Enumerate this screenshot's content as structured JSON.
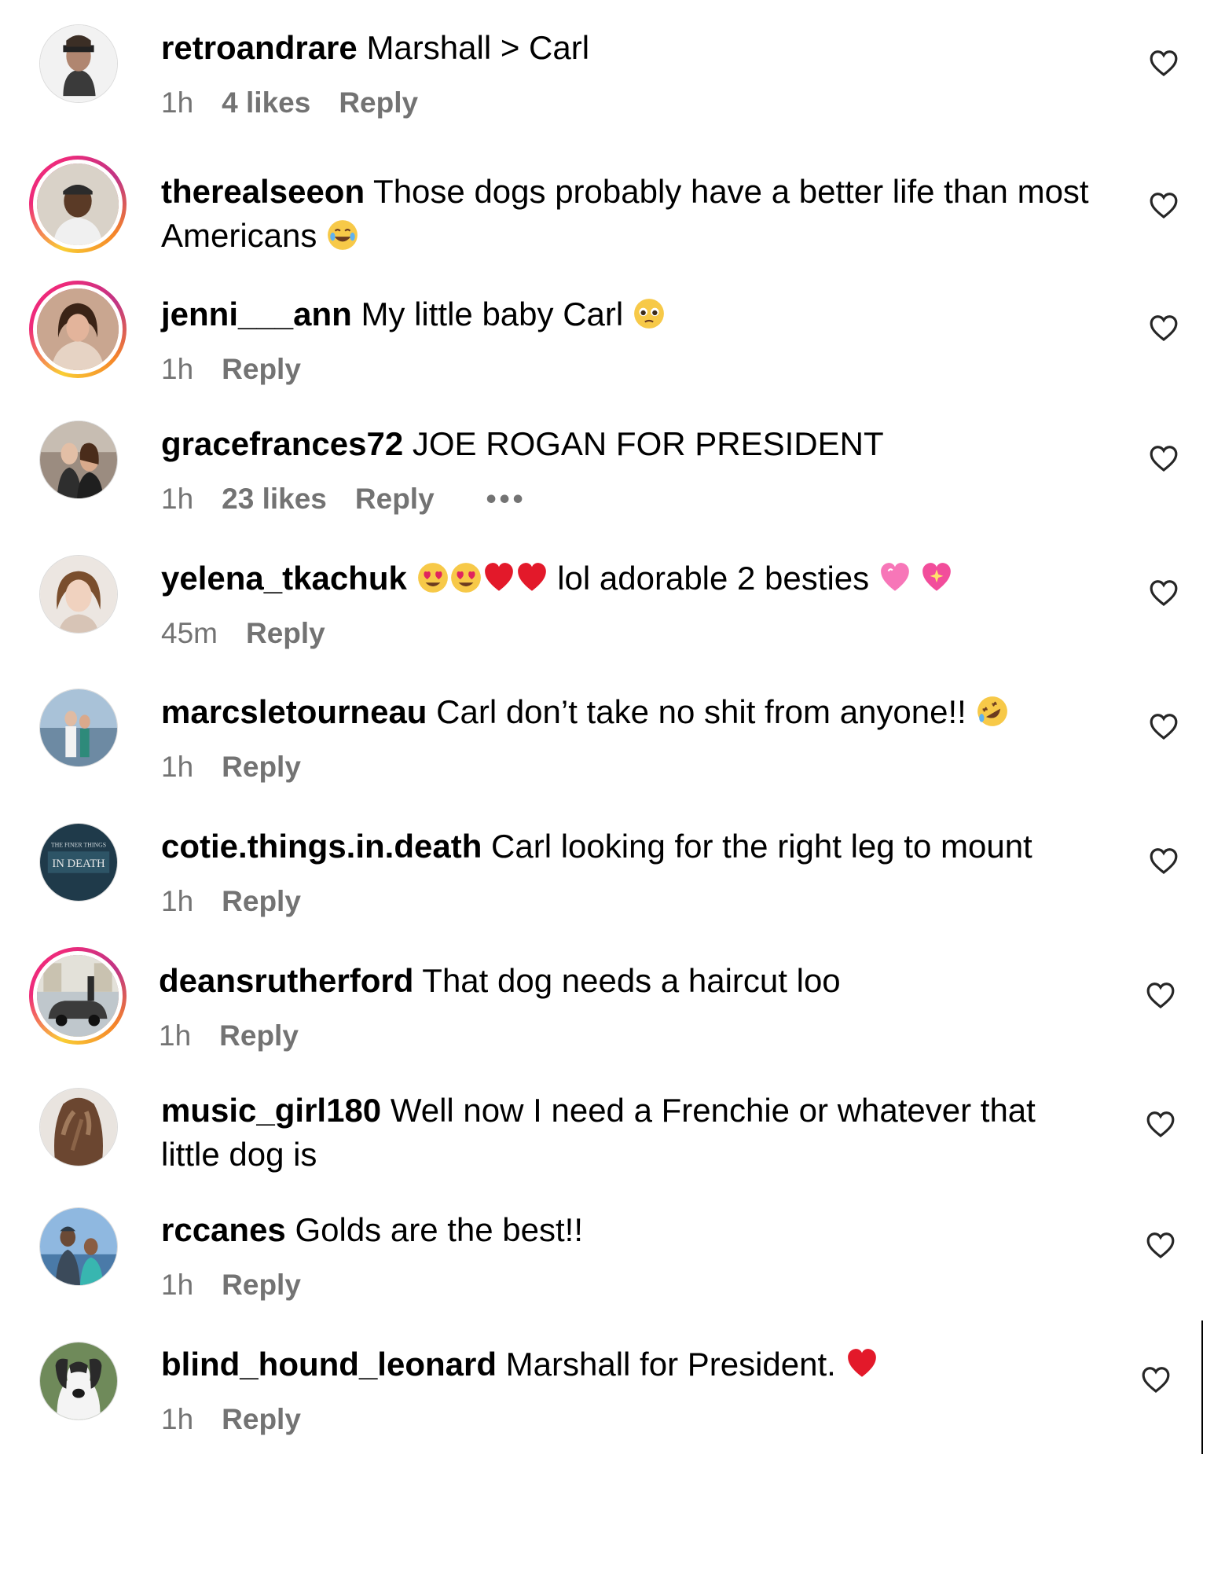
{
  "comments": [
    {
      "username": "retroandrare",
      "text": "Marshall > Carl",
      "time": "1h",
      "likes": "4 likes",
      "reply": "Reply",
      "emoji": [],
      "avatar": "avatar-snake-soldier",
      "story_ring": false
    },
    {
      "username": "therealseeon",
      "text": "Those dogs probably have a better life than most Americans",
      "time": "",
      "likes": "",
      "reply": "",
      "emoji": [
        "laughing-tears-emoji"
      ],
      "avatar": "avatar-man-cap",
      "story_ring": true
    },
    {
      "username": "jenni___ann",
      "text": "My little baby Carl",
      "time": "1h",
      "likes": "",
      "reply": "Reply",
      "emoji": [
        "pleading-face-emoji"
      ],
      "avatar": "avatar-woman-selfie",
      "story_ring": true
    },
    {
      "username": "gracefrances72",
      "text": "JOE ROGAN FOR PRESIDENT",
      "time": "1h",
      "likes": "23 likes",
      "reply": "Reply",
      "more": "•••",
      "emoji": [],
      "avatar": "avatar-couple-mirror",
      "story_ring": false
    },
    {
      "username": "yelena_tkachuk",
      "text": "lol adorable 2 besties",
      "time": "45m",
      "likes": "",
      "reply": "Reply",
      "emoji_before": [
        "heart-eyes-emoji",
        "heart-eyes-emoji",
        "red-heart-emoji",
        "red-heart-emoji"
      ],
      "emoji": [
        "heart-pulse-emoji",
        "sparkling-heart-emoji"
      ],
      "avatar": "avatar-woman-portrait",
      "story_ring": false
    },
    {
      "username": "marcsletourneau",
      "text": "Carl don’t take no shit from anyone!!",
      "time": "1h",
      "likes": "",
      "reply": "Reply",
      "emoji": [
        "rolling-laughing-emoji"
      ],
      "avatar": "avatar-couple-beach",
      "story_ring": false
    },
    {
      "username": "cotie.things.in.death",
      "text": "Carl looking for the right leg to mount",
      "time": "1h",
      "likes": "",
      "reply": "Reply",
      "emoji": [],
      "avatar": "avatar-book-logo",
      "story_ring": false
    },
    {
      "username": "deansrutherford",
      "text": "That dog needs a haircut loo",
      "time": "1h",
      "likes": "",
      "reply": "Reply",
      "emoji": [],
      "avatar": "avatar-vintage-car",
      "story_ring": true
    },
    {
      "username": "music_girl180",
      "text": "Well now I need a Frenchie or whatever that little dog is",
      "time": "",
      "likes": "",
      "reply": "",
      "emoji": [],
      "avatar": "avatar-wavy-hair",
      "story_ring": false
    },
    {
      "username": "rccanes",
      "text": "Golds are the best!!",
      "time": "1h",
      "likes": "",
      "reply": "Reply",
      "emoji": [],
      "avatar": "avatar-two-men",
      "story_ring": false
    },
    {
      "username": "blind_hound_leonard",
      "text": "Marshall for President.",
      "time": "1h",
      "likes": "",
      "reply": "Reply",
      "emoji": [
        "red-heart-emoji"
      ],
      "avatar": "avatar-hound-dog",
      "story_ring": false
    }
  ],
  "colors": {
    "meta_text": "#737373",
    "story_ring_gradient": [
      "#f9ce34",
      "#ee2a7b",
      "#c13584"
    ],
    "heart_outline": "#262626"
  },
  "icons": {
    "like": "heart-outline-icon"
  }
}
